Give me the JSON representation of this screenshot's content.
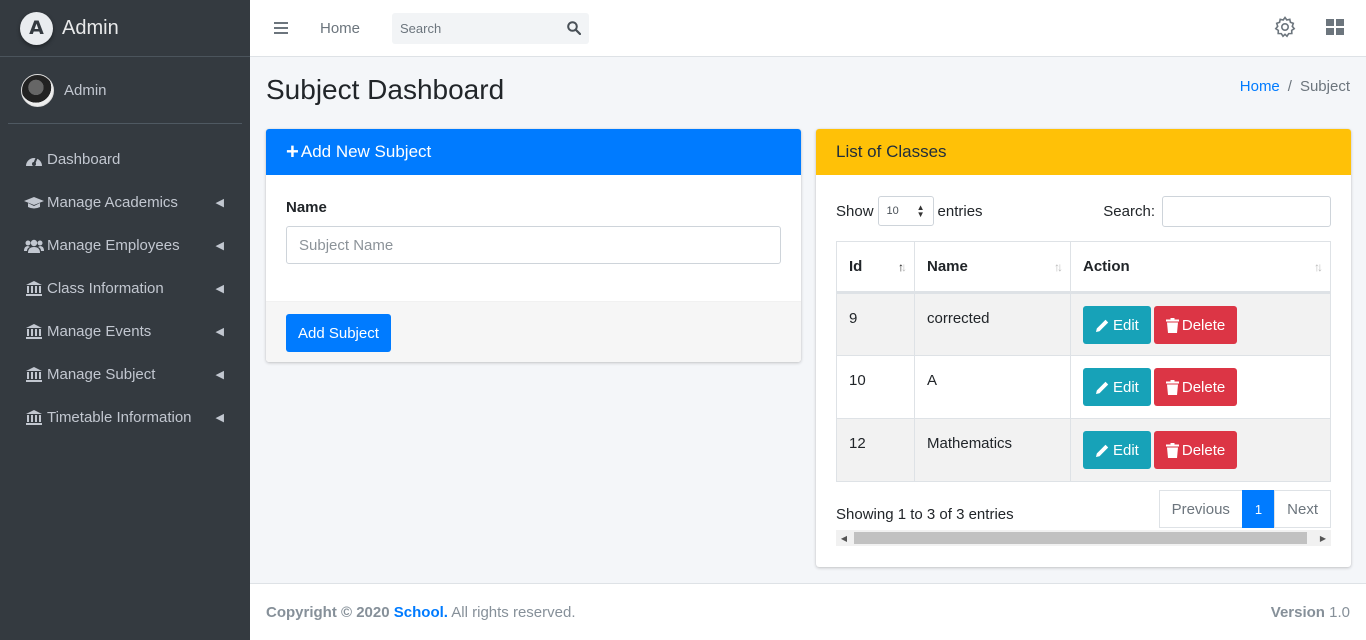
{
  "sidebar": {
    "brand": "Admin",
    "brand_logo_letter": "A",
    "user": "Admin",
    "items": [
      {
        "label": "Dashboard",
        "icon": "tachometer-icon",
        "arrow": false
      },
      {
        "label": "Manage Academics",
        "icon": "graduation-cap-icon",
        "arrow": true
      },
      {
        "label": "Manage Employees",
        "icon": "users-icon",
        "arrow": true
      },
      {
        "label": "Class Information",
        "icon": "university-icon",
        "arrow": true
      },
      {
        "label": "Manage Events",
        "icon": "university-icon",
        "arrow": true
      },
      {
        "label": "Manage Subject",
        "icon": "university-icon",
        "arrow": true
      },
      {
        "label": "Timetable Information",
        "icon": "university-icon",
        "arrow": true
      }
    ]
  },
  "topbar": {
    "home": "Home",
    "search_placeholder": "Search"
  },
  "header": {
    "title": "Subject Dashboard",
    "breadcrumb_home": "Home",
    "breadcrumb_sep": "/",
    "breadcrumb_current": "Subject"
  },
  "add_card": {
    "title": "Add New Subject",
    "name_label": "Name",
    "name_placeholder": "Subject Name",
    "submit": "Add Subject"
  },
  "list_card": {
    "title": "List of Classes",
    "show": "Show",
    "entries_value": "10",
    "entries": "entries",
    "search_label": "Search:",
    "columns": [
      "Id",
      "Name",
      "Action"
    ],
    "rows": [
      {
        "id": "9",
        "name": "corrected"
      },
      {
        "id": "10",
        "name": "A"
      },
      {
        "id": "12",
        "name": "Mathematics"
      }
    ],
    "edit_label": "Edit",
    "delete_label": "Delete",
    "info": "Showing 1 to 3 of 3 entries",
    "prev": "Previous",
    "page": "1",
    "next": "Next"
  },
  "footer": {
    "copyright": "Copyright © 2020",
    "brand": "School.",
    "rights": "All rights reserved.",
    "version_label": "Version",
    "version": "1.0"
  },
  "colors": {
    "primary": "#007bff",
    "warning": "#ffc107",
    "info": "#17a2b8",
    "danger": "#dc3545",
    "sidebar": "#343a40"
  }
}
